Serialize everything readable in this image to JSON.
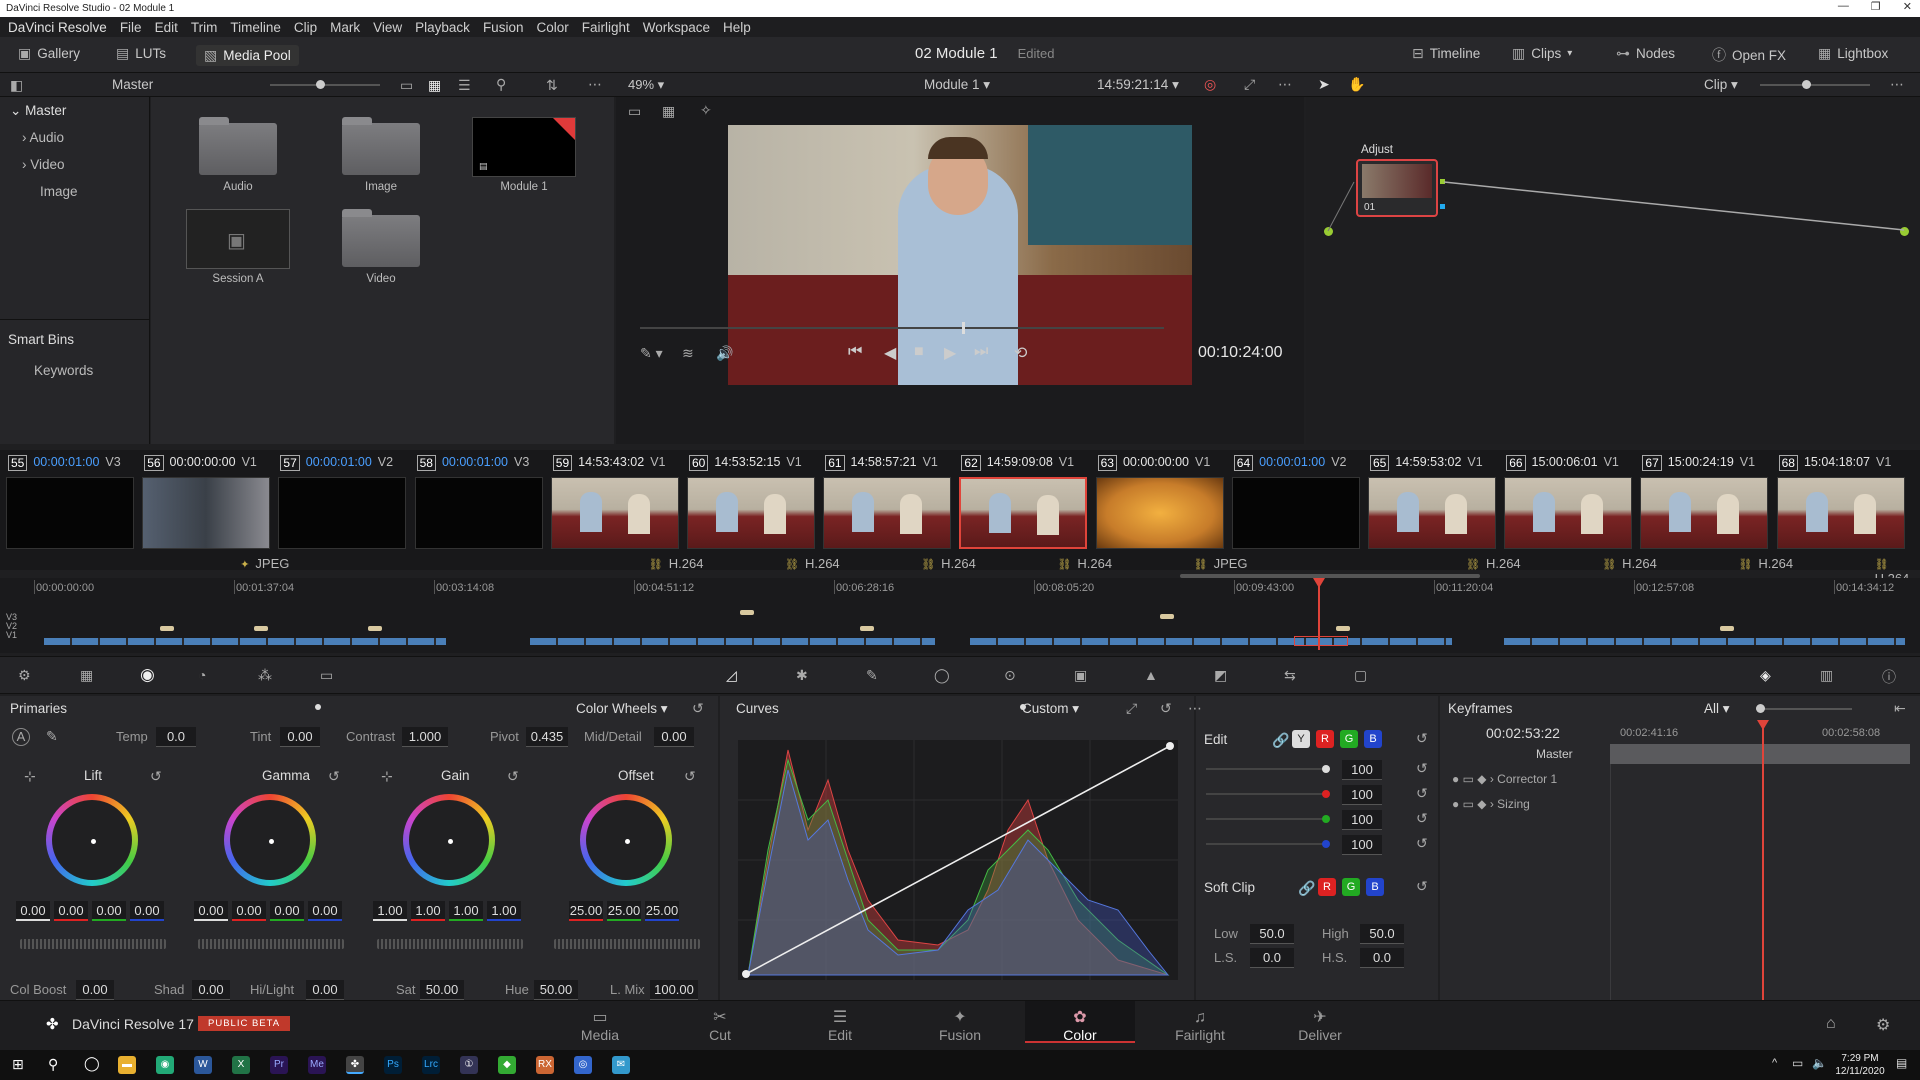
{
  "window": {
    "title": "DaVinci Resolve Studio - 02 Module 1"
  },
  "menu": [
    "DaVinci Resolve",
    "File",
    "Edit",
    "Trim",
    "Timeline",
    "Clip",
    "Mark",
    "View",
    "Playback",
    "Fusion",
    "Color",
    "Fairlight",
    "Workspace",
    "Help"
  ],
  "toolbar": {
    "gallery": "Gallery",
    "luts": "LUTs",
    "media_pool": "Media Pool",
    "project": "02 Module 1",
    "status": "Edited",
    "timeline": "Timeline",
    "clips": "Clips",
    "nodes": "Nodes",
    "openfx": "Open FX",
    "lightbox": "Lightbox"
  },
  "pool": {
    "bin": "Master",
    "zoom": "49%",
    "timeline_name": "Module 1",
    "timecode": "14:59:21:14",
    "clip_mode": "Clip"
  },
  "sidebar": {
    "master": "Master",
    "items": [
      "Audio",
      "Video",
      "Image"
    ],
    "smart_bins": "Smart Bins",
    "keywords": "Keywords"
  },
  "media": [
    {
      "label": "Audio"
    },
    {
      "label": "Image"
    },
    {
      "label": "Module 1"
    },
    {
      "label": "Session A"
    },
    {
      "label": "Video"
    }
  ],
  "viewer": {
    "timecode": "00:10:24:00"
  },
  "node": {
    "label": "Adjust",
    "num": "01"
  },
  "clips": [
    {
      "num": "55",
      "tc": "00:00:01:00",
      "track": "V3",
      "codec": "",
      "blue": true
    },
    {
      "num": "56",
      "tc": "00:00:00:00",
      "track": "V1",
      "codec": "JPEG",
      "blue": false
    },
    {
      "num": "57",
      "tc": "00:00:01:00",
      "track": "V2",
      "codec": "",
      "blue": true
    },
    {
      "num": "58",
      "tc": "00:00:01:00",
      "track": "V3",
      "codec": "",
      "blue": true
    },
    {
      "num": "59",
      "tc": "14:53:43:02",
      "track": "V1",
      "codec": "H.264",
      "blue": false
    },
    {
      "num": "60",
      "tc": "14:53:52:15",
      "track": "V1",
      "codec": "H.264",
      "blue": false
    },
    {
      "num": "61",
      "tc": "14:58:57:21",
      "track": "V1",
      "codec": "H.264",
      "blue": false
    },
    {
      "num": "62",
      "tc": "14:59:09:08",
      "track": "V1",
      "codec": "H.264",
      "blue": false
    },
    {
      "num": "63",
      "tc": "00:00:00:00",
      "track": "V1",
      "codec": "JPEG",
      "blue": false
    },
    {
      "num": "64",
      "tc": "00:00:01:00",
      "track": "V2",
      "codec": "",
      "blue": true
    },
    {
      "num": "65",
      "tc": "14:59:53:02",
      "track": "V1",
      "codec": "H.264",
      "blue": false
    },
    {
      "num": "66",
      "tc": "15:00:06:01",
      "track": "V1",
      "codec": "H.264",
      "blue": false
    },
    {
      "num": "67",
      "tc": "15:00:24:19",
      "track": "V1",
      "codec": "H.264",
      "blue": false
    },
    {
      "num": "68",
      "tc": "15:04:18:07",
      "track": "V1",
      "codec": "H.264",
      "blue": false
    }
  ],
  "ruler": [
    "00:00:00:00",
    "00:01:37:04",
    "00:03:14:08",
    "00:04:51:12",
    "00:06:28:16",
    "00:08:05:20",
    "00:09:43:00",
    "00:11:20:04",
    "00:12:57:08",
    "00:14:34:12"
  ],
  "tracks": [
    "V3",
    "V2",
    "V1"
  ],
  "primaries": {
    "title": "Primaries",
    "mode": "Color Wheels",
    "temp_label": "Temp",
    "temp": "0.0",
    "tint_label": "Tint",
    "tint": "0.00",
    "contrast_label": "Contrast",
    "contrast": "1.000",
    "pivot_label": "Pivot",
    "pivot": "0.435",
    "middetail_label": "Mid/Detail",
    "middetail": "0.00",
    "wheels": [
      {
        "name": "Lift",
        "vals": [
          "0.00",
          "0.00",
          "0.00",
          "0.00"
        ]
      },
      {
        "name": "Gamma",
        "vals": [
          "0.00",
          "0.00",
          "0.00",
          "0.00"
        ]
      },
      {
        "name": "Gain",
        "vals": [
          "1.00",
          "1.00",
          "1.00",
          "1.00"
        ]
      },
      {
        "name": "Offset",
        "vals": [
          "25.00",
          "25.00",
          "25.00"
        ]
      }
    ],
    "colboost_label": "Col Boost",
    "colboost": "0.00",
    "shad_label": "Shad",
    "shad": "0.00",
    "hilight_label": "Hi/Light",
    "hilight": "0.00",
    "sat_label": "Sat",
    "sat": "50.00",
    "hue_label": "Hue",
    "hue": "50.00",
    "lmix_label": "L. Mix",
    "lmix": "100.00"
  },
  "curves": {
    "title": "Curves",
    "mode": "Custom"
  },
  "edit": {
    "title": "Edit",
    "y": "Y",
    "r": "R",
    "g": "G",
    "b": "B",
    "vals": [
      "100",
      "100",
      "100",
      "100"
    ],
    "softclip": "Soft Clip",
    "low_label": "Low",
    "low": "50.0",
    "high_label": "High",
    "high": "50.0",
    "ls_label": "L.S.",
    "ls": "0.0",
    "hs_label": "H.S.",
    "hs": "0.0"
  },
  "keyframes": {
    "title": "Keyframes",
    "filter": "All",
    "tc": "00:02:53:22",
    "t1": "00:02:41:16",
    "t2": "00:02:58:08",
    "master": "Master",
    "rows": [
      "Corrector 1",
      "Sizing"
    ]
  },
  "brand": {
    "name": "DaVinci Resolve 17",
    "badge": "PUBLIC BETA"
  },
  "pages": [
    {
      "label": "Media",
      "icon": "▭"
    },
    {
      "label": "Cut",
      "icon": "✂"
    },
    {
      "label": "Edit",
      "icon": "☰"
    },
    {
      "label": "Fusion",
      "icon": "✦"
    },
    {
      "label": "Color",
      "icon": "✿"
    },
    {
      "label": "Fairlight",
      "icon": "♫"
    },
    {
      "label": "Deliver",
      "icon": "✈"
    }
  ],
  "active_page": "Color",
  "clock": {
    "time": "7:29 PM",
    "date": "12/11/2020"
  }
}
